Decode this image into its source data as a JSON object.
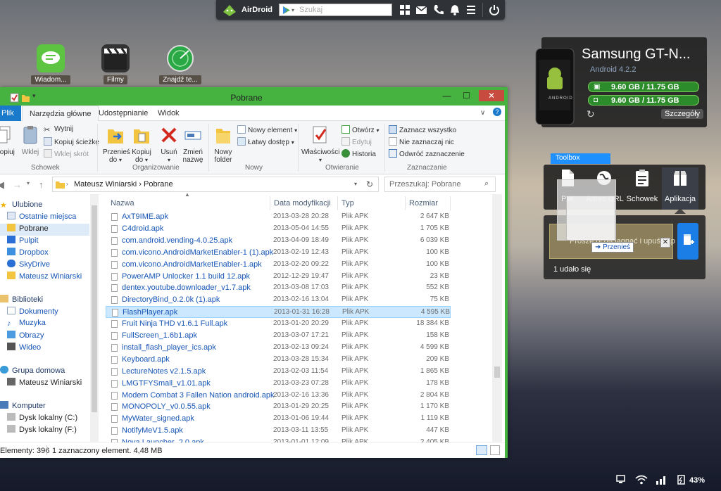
{
  "airdroid": {
    "name": "AirDroid",
    "search_placeholder": "Szukaj"
  },
  "desktop_icons": [
    {
      "label": "Wiadom...",
      "color": "#5cc440"
    },
    {
      "label": "Filmy",
      "color": "#333333"
    },
    {
      "label": "Znajdź te...",
      "color": "#2aa845"
    }
  ],
  "device": {
    "name": "Samsung GT-N...",
    "os": "Android 4.2.2",
    "storage_1": "9.60 GB / 11.75 GB",
    "storage_2": "9.60 GB / 11.75 GB",
    "details": "Szczegóły"
  },
  "toolbox": {
    "tab": "Toolbox",
    "tools": [
      "Plik",
      "Adres URL",
      "Schowek",
      "Aplikacja"
    ],
    "drop_text": "Proszę przeciągnąć i upuść aplikację, aby zainstalować na",
    "move_tip": "Przenieś",
    "status": "1 udało się"
  },
  "explorer": {
    "title": "Pobrane",
    "tabs": [
      "Plik",
      "Narzędzia główne",
      "Udostępnianie",
      "Widok"
    ],
    "ribbon": {
      "schowek": {
        "label": "Schowek",
        "copy": "Kopiuj",
        "paste": "Wklej",
        "cut": "Wytnij",
        "copy_path": "Kopiuj ścieżkę",
        "paste_shortcut": "Wklej skrót"
      },
      "organizowanie": {
        "label": "Organizowanie",
        "move_to_1": "Przenieś",
        "move_to_2": "do",
        "copy_to_1": "Kopiuj",
        "copy_to_2": "do",
        "delete": "Usuń",
        "rename_1": "Zmień",
        "rename_2": "nazwę"
      },
      "nowy": {
        "label": "Nowy",
        "new_folder_1": "Nowy",
        "new_folder_2": "folder",
        "new_item": "Nowy element",
        "easy_access": "Łatwy dostęp"
      },
      "otwieranie": {
        "label": "Otwieranie",
        "properties": "Właściwości",
        "open": "Otwórz",
        "edit": "Edytuj",
        "history": "Historia"
      },
      "zaznaczanie": {
        "label": "Zaznaczanie",
        "select_all": "Zaznacz wszystko",
        "select_none": "Nie zaznaczaj nic",
        "invert": "Odwróć zaznaczenie"
      }
    },
    "address": "Mateusz Winiarski  ›  Pobrane",
    "search_placeholder": "Przeszukaj: Pobrane",
    "nav": {
      "favorites": "Ulubione",
      "recent": "Ostatnie miejsca",
      "downloads": "Pobrane",
      "desktop": "Pulpit",
      "dropbox": "Dropbox",
      "skydrive": "SkyDrive",
      "user": "Mateusz Winiarski",
      "libraries": "Biblioteki",
      "documents": "Dokumenty",
      "music": "Muzyka",
      "pictures": "Obrazy",
      "videos": "Wideo",
      "homegroup": "Grupa domowa",
      "homegroup_user": "Mateusz Winiarski",
      "computer": "Komputer",
      "disk_c": "Dysk lokalny (C:)",
      "disk_f": "Dysk lokalny (F:)"
    },
    "columns": [
      "Nazwa",
      "Data modyfikacji",
      "Typ",
      "Rozmiar"
    ],
    "files": [
      {
        "name": "AxT9IME.apk",
        "date": "2013-03-28 20:28",
        "type": "Plik APK",
        "size": "2 647 KB"
      },
      {
        "name": "C4droid.apk",
        "date": "2013-05-04 14:55",
        "type": "Plik APK",
        "size": "1 705 KB"
      },
      {
        "name": "com.android.vending-4.0.25.apk",
        "date": "2013-04-09 18:49",
        "type": "Plik APK",
        "size": "6 039 KB"
      },
      {
        "name": "com.vicono.AndroidMarketEnabler-1 (1).apk",
        "date": "2013-02-19 12:43",
        "type": "Plik APK",
        "size": "100 KB"
      },
      {
        "name": "com.vicono.AndroidMarketEnabler-1.apk",
        "date": "2013-02-20 09:22",
        "type": "Plik APK",
        "size": "100 KB"
      },
      {
        "name": "PowerAMP Unlocker 1.1 build 12.apk",
        "date": "2012-12-29 19:47",
        "type": "Plik APK",
        "size": "23 KB"
      },
      {
        "name": "dentex.youtube.downloader_v1.7.apk",
        "date": "2013-03-08 17:03",
        "type": "Plik APK",
        "size": "552 KB"
      },
      {
        "name": "DirectoryBind_0.2.0k (1).apk",
        "date": "2013-02-16 13:04",
        "type": "Plik APK",
        "size": "75 KB"
      },
      {
        "name": "FlashPlayer.apk",
        "date": "2013-01-31 16:28",
        "type": "Plik APK",
        "size": "4 595 KB"
      },
      {
        "name": "Fruit Ninja THD v1.6.1 Full.apk",
        "date": "2013-01-20 20:29",
        "type": "Plik APK",
        "size": "18 384 KB"
      },
      {
        "name": "FullScreen_1.6b1.apk",
        "date": "2013-03-07 17:21",
        "type": "Plik APK",
        "size": "158 KB"
      },
      {
        "name": "install_flash_player_ics.apk",
        "date": "2013-02-13 09:24",
        "type": "Plik APK",
        "size": "4 599 KB"
      },
      {
        "name": "Keyboard.apk",
        "date": "2013-03-28 15:34",
        "type": "Plik APK",
        "size": "209 KB"
      },
      {
        "name": "LectureNotes v2.1.5.apk",
        "date": "2013-02-03 11:54",
        "type": "Plik APK",
        "size": "1 865 KB"
      },
      {
        "name": "LMGTFYSmall_v1.01.apk",
        "date": "2013-03-23 07:28",
        "type": "Plik APK",
        "size": "178 KB"
      },
      {
        "name": "Modern Combat 3 Fallen Nation android.apk",
        "date": "2013-02-16 13:36",
        "type": "Plik APK",
        "size": "2 804 KB"
      },
      {
        "name": "MONOPOLY_v0.0.55.apk",
        "date": "2013-01-29 20:25",
        "type": "Plik APK",
        "size": "1 170 KB"
      },
      {
        "name": "MyWater_signed.apk",
        "date": "2013-01-06 19:44",
        "type": "Plik APK",
        "size": "1 119 KB"
      },
      {
        "name": "NotifyMeV1.5.apk",
        "date": "2013-03-11 13:55",
        "type": "Plik APK",
        "size": "447 KB"
      },
      {
        "name": "Nova Launcher_2.0.apk",
        "date": "2013-01-01 12:09",
        "type": "Plik APK",
        "size": "2 405 KB"
      }
    ],
    "status_count": "Elementy: 396",
    "status_selected": "1 zaznaczony element. 4,48 MB"
  },
  "tray": {
    "battery": "43%"
  }
}
